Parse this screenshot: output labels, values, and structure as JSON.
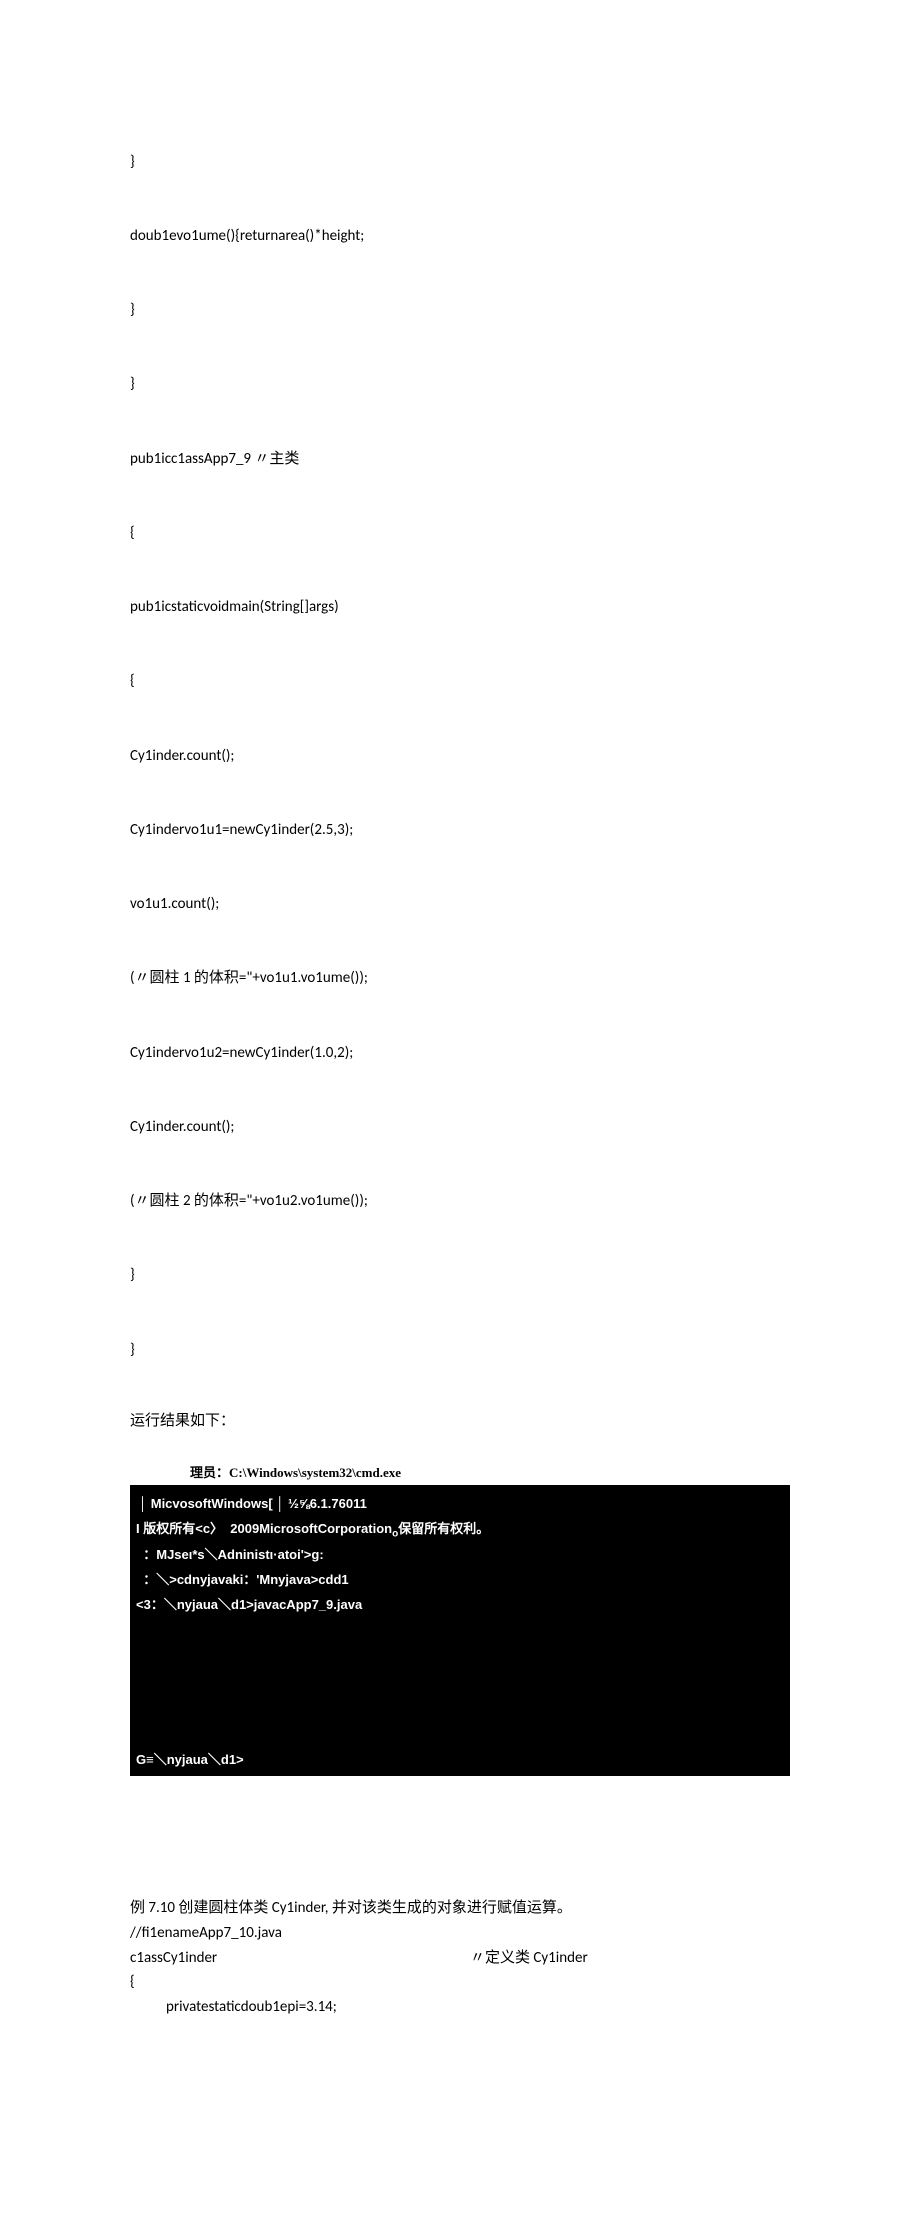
{
  "code1": {
    "l0": "}",
    "l1": "doub1evo1ume(){returnarea()*height;",
    "l2": "}",
    "l3": "}",
    "l4a": "pub1icc1assApp7_9",
    "l4b": "〃主类",
    "l5": "{",
    "l6": "pub1icstaticvoidmain(String[]args)",
    "l7": "{",
    "l8": "Cy1inder.count();",
    "l9": "Cy1indervo1u1=newCy1inder(2.5,3);",
    "l10": "vo1u1.count();",
    "l11": "(〃圆柱 1 的体积=\"+vo1u1.vo1ume());",
    "l12": "Cy1indervo1u2=newCy1inder(1.0,2);",
    "l13": "Cy1inder.count();",
    "l14": "(〃圆柱 2 的体积=\"+vo1u2.vo1ume());",
    "l15": "}",
    "l16": "}"
  },
  "result_label": "运行结果如下：",
  "cmd_title": "理员：C:\\Windows\\system32\\cmd.exe",
  "cmd": {
    "l0a": "│ MicvosoftWindows[ │ ½⅝6.1.76011",
    "l1a": "I 版权所有<c〉  2009MicrosoftCorporation",
    "l1b": "o",
    "l1c": "保留所有权利。",
    "l2": "",
    "l3": "  ：MJseι*s＼Adninistι·atoi'>g:",
    "l4": "",
    "l5": "  ：＼>cdnyjavaki：'Mnyjava>cdd1",
    "l6": "",
    "l7": "<3：＼nyjaua＼d1>javacApp7_9.java",
    "prompt": "G≡＼nyjaua＼d1>"
  },
  "section": {
    "s0": "例 7.10 创建圆柱体类 Cy1inder, 并对该类生成的对象进行赋值运算。",
    "s1": "//fi1enameApp7_10.java",
    "s2a": "c1assCy1inder",
    "s2b": "〃定义类 Cy1inder",
    "s3": "{",
    "s4": "privatestaticdoub1epi=3.14;"
  }
}
